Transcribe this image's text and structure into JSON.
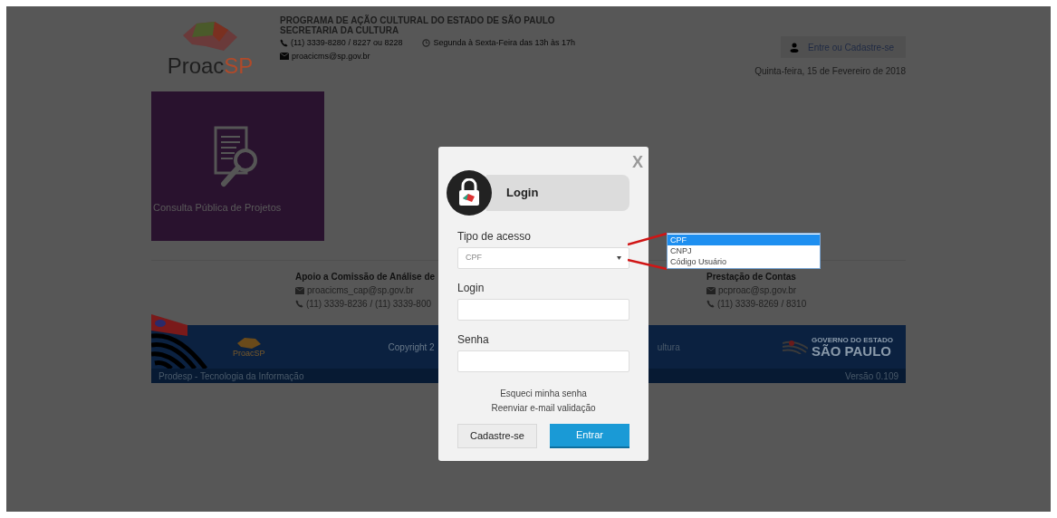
{
  "header": {
    "logo": [
      {
        "text": "Proac",
        "color": "#1e1e1e"
      },
      {
        "text": "SP",
        "color": "#b04a2a"
      }
    ],
    "title": "PROGRAMA DE AÇÃO CULTURAL DO ESTADO DE SÃO PAULO",
    "subtitle": "SECRETARIA DA CULTURA",
    "phone": "(11) 3339-8280 / 8227 ou 8228",
    "hours": "Segunda à Sexta-Feira das 13h às 17h",
    "email": "proacicms@sp.gov.br",
    "account_button": "Entre ou Cadastre-se",
    "date": "Quinta-feira, 15 de Fevereiro de 2018"
  },
  "tile": {
    "label": "Consulta Pública de Projetos"
  },
  "contacts": [
    {
      "title": "Apoio a Comissão de Análise de",
      "email": "proacicms_cap@sp.gov.br",
      "phone": "(11) 3339-8236 / (11) 3339-800"
    },
    {
      "title": "Prestação de Contas",
      "email": "pcproac@sp.gov.br",
      "phone": "(11) 3339-8269 / 8310"
    }
  ],
  "footer": {
    "logo": "ProacSP",
    "copyright": "Copyright 2",
    "copyright_end": "ultura",
    "gov_small": "GOVERNO DO ESTADO",
    "gov_big": "SÃO PAULO",
    "left": "Prodesp - Tecnologia da Informação",
    "version": "Versão 0.109"
  },
  "modal": {
    "close": "X",
    "title": "Login",
    "fields": [
      {
        "kind": "select",
        "label": "Tipo de acesso",
        "value": "CPF"
      },
      {
        "kind": "text",
        "label": "Login"
      },
      {
        "kind": "password",
        "label": "Senha"
      }
    ],
    "links": [
      "Esqueci minha senha",
      "Reenviar e-mail validação"
    ],
    "buttons": [
      {
        "kind": "secondary",
        "label": "Cadastre-se"
      },
      {
        "kind": "primary",
        "label": "Entrar"
      }
    ]
  },
  "dropdown": [
    {
      "label": "CPF",
      "selected": true
    },
    {
      "label": "CNPJ",
      "selected": false
    },
    {
      "label": "Código Usuário",
      "selected": false
    }
  ]
}
